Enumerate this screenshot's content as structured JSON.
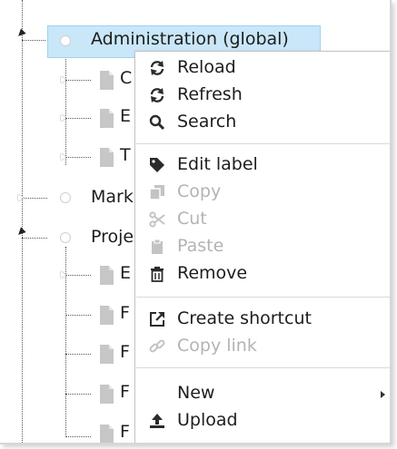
{
  "tree": {
    "nodes": [
      {
        "label": "Administration (global)",
        "selected": true
      },
      {
        "label": "C"
      },
      {
        "label": "E"
      },
      {
        "label": "T"
      },
      {
        "label": "Mark"
      },
      {
        "label": "Proje"
      },
      {
        "label": "E"
      },
      {
        "label": "F"
      },
      {
        "label": "F"
      },
      {
        "label": "F"
      },
      {
        "label": "F"
      }
    ]
  },
  "context_menu": {
    "items": [
      {
        "label": "Reload",
        "icon": "reload-icon",
        "disabled": false
      },
      {
        "label": "Refresh",
        "icon": "refresh-icon",
        "disabled": false
      },
      {
        "label": "Search",
        "icon": "search-icon",
        "disabled": false
      },
      {
        "label": "Edit label",
        "icon": "tag-icon",
        "disabled": false
      },
      {
        "label": "Copy",
        "icon": "copy-icon",
        "disabled": true
      },
      {
        "label": "Cut",
        "icon": "scissors-icon",
        "disabled": true
      },
      {
        "label": "Paste",
        "icon": "clipboard-icon",
        "disabled": true
      },
      {
        "label": "Remove",
        "icon": "trash-icon",
        "disabled": false
      },
      {
        "label": "Create shortcut",
        "icon": "external-link-icon",
        "disabled": false
      },
      {
        "label": "Copy link",
        "icon": "link-icon",
        "disabled": true
      },
      {
        "label": "New",
        "icon": "",
        "disabled": false,
        "submenu": true
      },
      {
        "label": "Upload",
        "icon": "upload-icon",
        "disabled": false
      }
    ]
  },
  "colors": {
    "selection": "#c9e7f8",
    "icon_dark": "#2b2b2b",
    "icon_disabled": "#c3c3c3",
    "text_disabled": "#b3b3b3"
  }
}
